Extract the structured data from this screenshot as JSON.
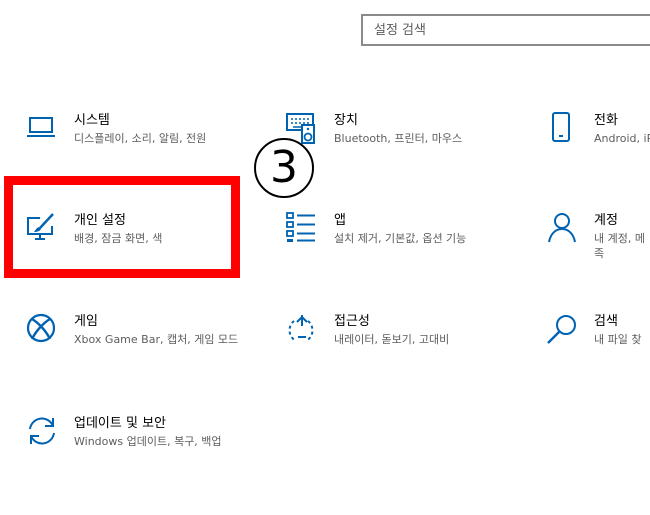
{
  "search": {
    "placeholder": "설정 검색"
  },
  "accent_color": "#0063b1",
  "highlight_color": "#ff0000",
  "step_marker": "③",
  "categories": [
    {
      "id": "system",
      "icon": "laptop-icon",
      "title": "시스템",
      "description": "디스플레이, 소리, 알림, 전원"
    },
    {
      "id": "devices",
      "icon": "keyboard-speaker-icon",
      "title": "장치",
      "description": "Bluetooth, 프린터, 마우스"
    },
    {
      "id": "phone",
      "icon": "phone-icon",
      "title": "전화",
      "description": "Android, iP"
    },
    {
      "id": "personalization",
      "icon": "paint-monitor-icon",
      "title": "개인 설정",
      "description": "배경, 잠금 화면, 색"
    },
    {
      "id": "apps",
      "icon": "apps-list-icon",
      "title": "앱",
      "description": "설치 제거, 기본값, 옵션 기능"
    },
    {
      "id": "accounts",
      "icon": "person-icon",
      "title": "계정",
      "description": "내 계정, 메\n족"
    },
    {
      "id": "gaming",
      "icon": "xbox-icon",
      "title": "게임",
      "description": "Xbox Game Bar, 캡처, 게임 모드"
    },
    {
      "id": "ease-of-access",
      "icon": "ease-of-access-icon",
      "title": "접근성",
      "description": "내레이터, 돋보기, 고대비"
    },
    {
      "id": "search",
      "icon": "search-icon",
      "title": "검색",
      "description": "내 파일 찾"
    },
    {
      "id": "update-security",
      "icon": "sync-icon",
      "title": "업데이트 및 보안",
      "description": "Windows 업데이트, 복구, 백업"
    }
  ]
}
